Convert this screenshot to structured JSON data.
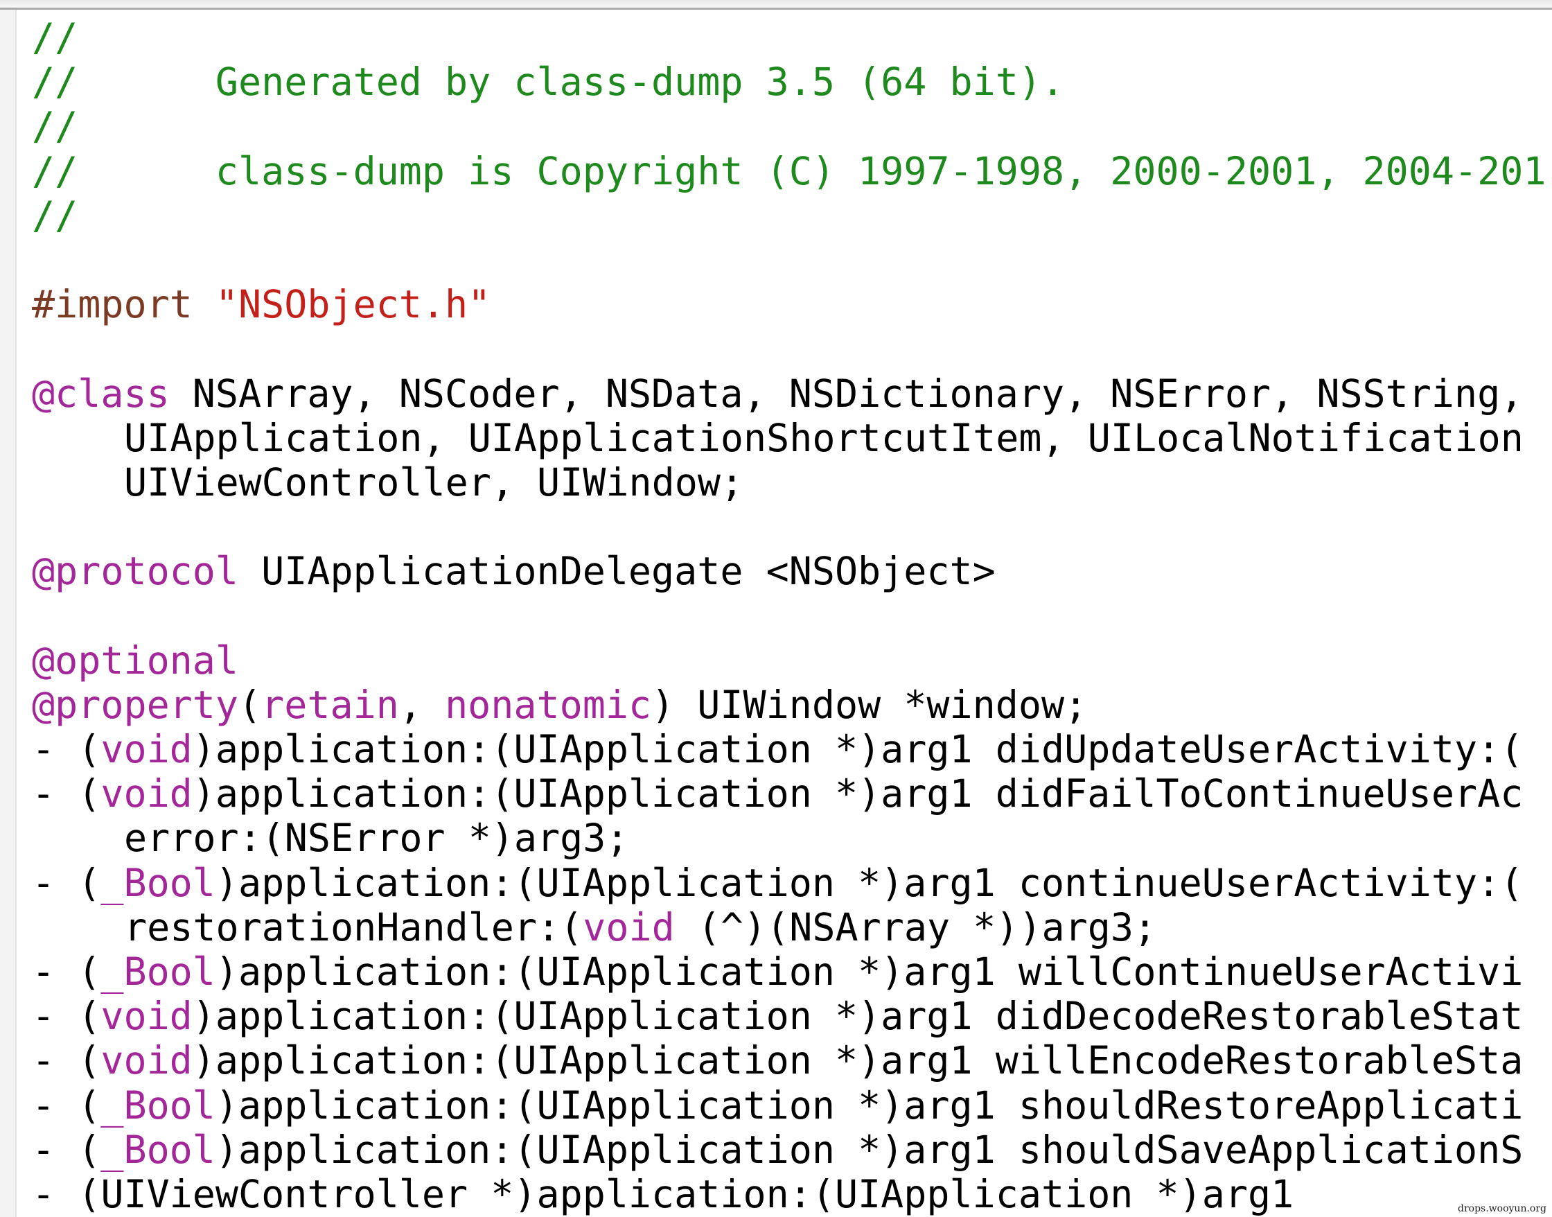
{
  "colors": {
    "comment": "#1e8a1e",
    "preprocessor": "#7b3a23",
    "string": "#c4201a",
    "keyword": "#a4279a",
    "text": "#000000"
  },
  "code": {
    "l1": "//",
    "l2": "//      Generated by class-dump 3.5 (64 bit).",
    "l3": "//",
    "l4": "//      class-dump is Copyright (C) 1997-1998, 2000-2001, 2004-201",
    "l5": "//",
    "l7_directive": "#import ",
    "l7_string": "\"NSObject.h\"",
    "l9_keyword": "@class",
    "l9_rest": " NSArray, NSCoder, NSData, NSDictionary, NSError, NSString,",
    "l10": "UIApplication, UIApplicationShortcutItem, UILocalNotification",
    "l11": "UIViewController, UIWindow;",
    "l13_keyword": "@protocol",
    "l13_rest": " UIApplicationDelegate <NSObject>",
    "l15_keyword": "@optional",
    "l16_keyword": "@property",
    "l16_p1": "(",
    "l16_attr1": "retain",
    "l16_p2": ", ",
    "l16_attr2": "nonatomic",
    "l16_rest": ") UIWindow *window;",
    "l17_pre": "- (",
    "l17_type": "void",
    "l17_rest": ")application:(UIApplication *)arg1 didUpdateUserActivity:(",
    "l18_pre": "- (",
    "l18_type": "void",
    "l18_rest": ")application:(UIApplication *)arg1 didFailToContinueUserAc",
    "l19": "error:(NSError *)arg3;",
    "l20_pre": "- (",
    "l20_type": "_Bool",
    "l20_rest": ")application:(UIApplication *)arg1 continueUserActivity:(",
    "l21_pre": "restorationHandler:(",
    "l21_type": "void",
    "l21_rest": " (^)(NSArray *))arg3;",
    "l22_pre": "- (",
    "l22_type": "_Bool",
    "l22_rest": ")application:(UIApplication *)arg1 willContinueUserActivi",
    "l23_pre": "- (",
    "l23_type": "void",
    "l23_rest": ")application:(UIApplication *)arg1 didDecodeRestorableStat",
    "l24_pre": "- (",
    "l24_type": "void",
    "l24_rest": ")application:(UIApplication *)arg1 willEncodeRestorableSta",
    "l25_pre": "- (",
    "l25_type": "_Bool",
    "l25_rest": ")application:(UIApplication *)arg1 shouldRestoreApplicati",
    "l26_pre": "- (",
    "l26_type": "_Bool",
    "l26_rest": ")application:(UIApplication *)arg1 shouldSaveApplicationS",
    "l27": "- (UIViewController *)application:(UIApplication *)arg1"
  },
  "watermark": "drops.wooyun.org"
}
